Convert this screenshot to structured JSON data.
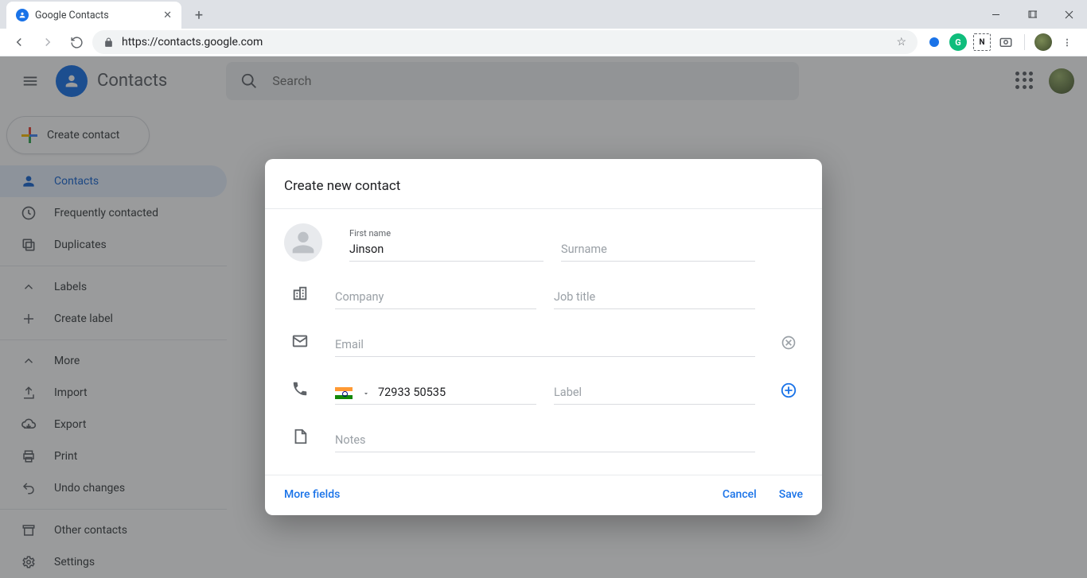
{
  "browser": {
    "tab_title": "Google Contacts",
    "url": "https://contacts.google.com"
  },
  "app": {
    "title": "Contacts",
    "search_placeholder": "Search",
    "create_button": "Create contact"
  },
  "sidebar": {
    "items": [
      {
        "label": "Contacts"
      },
      {
        "label": "Frequently contacted"
      },
      {
        "label": "Duplicates"
      },
      {
        "label": "Labels"
      },
      {
        "label": "Create label"
      },
      {
        "label": "More"
      },
      {
        "label": "Import"
      },
      {
        "label": "Export"
      },
      {
        "label": "Print"
      },
      {
        "label": "Undo changes"
      },
      {
        "label": "Other contacts"
      },
      {
        "label": "Settings"
      }
    ]
  },
  "dialog": {
    "title": "Create new contact",
    "firstname_label": "First name",
    "firstname_value": "Jinson",
    "surname_placeholder": "Surname",
    "company_placeholder": "Company",
    "jobtitle_placeholder": "Job title",
    "email_placeholder": "Email",
    "phone_value": "72933 50535",
    "phone_label_placeholder": "Label",
    "notes_placeholder": "Notes",
    "more_fields": "More fields",
    "cancel": "Cancel",
    "save": "Save"
  }
}
